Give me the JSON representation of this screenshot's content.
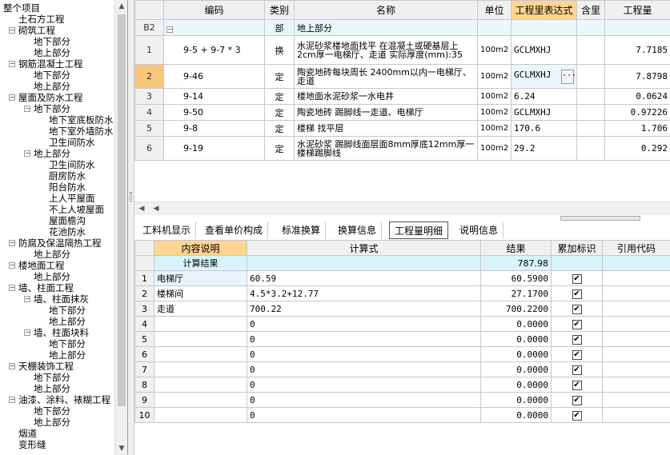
{
  "tree": {
    "items": [
      {
        "label": "整个项目"
      },
      {
        "label": "土石方工程"
      },
      {
        "label": "砌筑工程"
      },
      {
        "label": "地下部分"
      },
      {
        "label": "地上部分"
      },
      {
        "label": "钢筋混凝土工程"
      },
      {
        "label": "地下部分"
      },
      {
        "label": "地上部分"
      },
      {
        "label": "屋面及防水工程"
      },
      {
        "label": "地下部分"
      },
      {
        "label": "地下室底板防水"
      },
      {
        "label": "地下室外墙防水"
      },
      {
        "label": "卫生间防水"
      },
      {
        "label": "地上部分"
      },
      {
        "label": "卫生间防水"
      },
      {
        "label": "厨房防水"
      },
      {
        "label": "阳台防水"
      },
      {
        "label": "上人平屋面"
      },
      {
        "label": "不上人坡屋面"
      },
      {
        "label": "屋面檐沟"
      },
      {
        "label": "花池防水"
      },
      {
        "label": "防腐及保温隔热工程"
      },
      {
        "label": "地上部分"
      },
      {
        "label": "楼地面工程"
      },
      {
        "label": "地上部分"
      },
      {
        "label": "墙、柱面工程"
      },
      {
        "label": "墙、柱面抹灰"
      },
      {
        "label": "地下部分"
      },
      {
        "label": "地上部分"
      },
      {
        "label": "墙、柱面块料"
      },
      {
        "label": "地下部分"
      },
      {
        "label": "地上部分"
      },
      {
        "label": "天棚装饰工程"
      },
      {
        "label": "地下部分"
      },
      {
        "label": "地上部分"
      },
      {
        "label": "油漆、涂料、裱糊工程"
      },
      {
        "label": "地下部分"
      },
      {
        "label": "地上部分"
      },
      {
        "label": "烟道"
      },
      {
        "label": "变形缝"
      }
    ]
  },
  "grid1": {
    "headers": [
      "编码",
      "类别",
      "名称",
      "单位",
      "工程里表达式",
      "含里",
      "工程量"
    ],
    "group": {
      "rownum": "B2",
      "toggle": "−",
      "type": "部",
      "name": "地上部分"
    },
    "rows": [
      {
        "n": "1",
        "code": "9-5 + 9-7 * 3",
        "type": "换",
        "name": "水泥砂浆楼地面找平 在混凝土或硬基层上 2cm厚一电梯厅、走道 实际厚度(mm):35",
        "unit": "100m2",
        "expr": "GCLMXHJ",
        "qty": "7.7185"
      },
      {
        "n": "2",
        "code": "9-46",
        "type": "定",
        "name": "陶瓷地砖每块周长 2400mm以内一电梯厅、走道",
        "unit": "100m2",
        "expr": "GCLMXHJ",
        "qty": "7.8798"
      },
      {
        "n": "3",
        "code": "9-14",
        "type": "定",
        "name": "楼地面水泥砂浆一水电井",
        "unit": "100m2",
        "expr": "6.24",
        "qty": "0.0624"
      },
      {
        "n": "4",
        "code": "9-50",
        "type": "定",
        "name": "陶瓷地砖 踢脚线一走道、电梯厅",
        "unit": "100m2",
        "expr": "GCLMXHJ",
        "qty": "0.97226"
      },
      {
        "n": "5",
        "code": "9-8",
        "type": "定",
        "name": "楼梯 找平层",
        "unit": "100m2",
        "expr": "170.6",
        "qty": "1.706"
      },
      {
        "n": "6",
        "code": "9-19",
        "type": "定",
        "name": "水泥砂浆 踢脚线面层面8mm厚底12mm厚一楼梯踢脚线",
        "unit": "100m2",
        "expr": "29.2",
        "qty": "0.292"
      }
    ],
    "ellipsis": "···"
  },
  "tabs": [
    {
      "label": "工料机显示"
    },
    {
      "label": "查看单价构成"
    },
    {
      "label": "标准换算"
    },
    {
      "label": "换算信息"
    },
    {
      "label": "工程量明细"
    },
    {
      "label": "说明信息"
    }
  ],
  "grid2": {
    "headers": [
      "内容说明",
      "计算式",
      "结果",
      "累加标识",
      "引用代码"
    ],
    "calc": {
      "label": "计算结果",
      "result": "787.98"
    },
    "rows": [
      {
        "n": "1",
        "desc": "电梯厅",
        "formula": "60.59",
        "result": "60.5900"
      },
      {
        "n": "2",
        "desc": "楼梯间",
        "formula": "4.5*3.2+12.77",
        "result": "27.1700"
      },
      {
        "n": "3",
        "desc": "走道",
        "formula": "700.22",
        "result": "700.2200"
      },
      {
        "n": "4",
        "desc": "",
        "formula": "0",
        "result": "0.0000"
      },
      {
        "n": "5",
        "desc": "",
        "formula": "0",
        "result": "0.0000"
      },
      {
        "n": "6",
        "desc": "",
        "formula": "0",
        "result": "0.0000"
      },
      {
        "n": "7",
        "desc": "",
        "formula": "0",
        "result": "0.0000"
      },
      {
        "n": "8",
        "desc": "",
        "formula": "0",
        "result": "0.0000"
      },
      {
        "n": "9",
        "desc": "",
        "formula": "0",
        "result": "0.0000"
      },
      {
        "n": "10",
        "desc": "",
        "formula": "0",
        "result": "0.0000"
      }
    ],
    "check": "✔"
  },
  "colors": {
    "header_highlight": "#ffd590",
    "selected_row": "#f8c77a",
    "calc_row": "#d8f4fb"
  },
  "icons": {
    "scroll_up": "chevron-up-icon",
    "scroll_down": "chevron-down-icon",
    "collapse": "minus-box-icon"
  }
}
